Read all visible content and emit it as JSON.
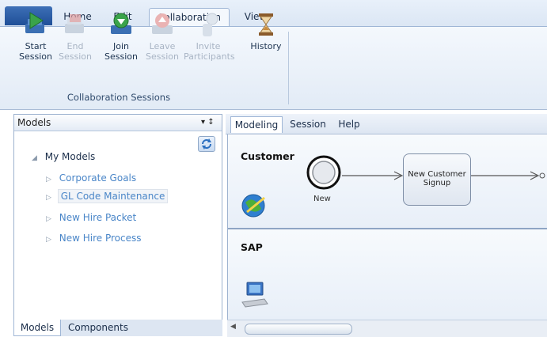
{
  "ribbon": {
    "tabs": [
      "Home",
      "Edit",
      "Collaboration",
      "View"
    ],
    "active_tab": "Collaboration",
    "buttons": [
      {
        "line1": "Start",
        "line2": "Session",
        "icon": "start-session-icon",
        "enabled": true
      },
      {
        "line1": "End",
        "line2": "Session",
        "icon": "end-session-icon",
        "enabled": false
      },
      {
        "line1": "Join",
        "line2": "Session",
        "icon": "join-session-icon",
        "enabled": true
      },
      {
        "line1": "Leave",
        "line2": "Session",
        "icon": "leave-session-icon",
        "enabled": false
      },
      {
        "line1": "Invite",
        "line2": "Participants",
        "icon": "invite-participants-icon",
        "enabled": false
      },
      {
        "line1": "History",
        "line2": "",
        "icon": "history-icon",
        "enabled": true
      }
    ],
    "group_label": "Collaboration Sessions"
  },
  "models_panel": {
    "title": "Models",
    "pin_glyph": "▾ ↕",
    "root": "My Models",
    "items": [
      "Corporate Goals",
      "GL Code Maintenance",
      "New Hire Packet",
      "New Hire Process"
    ],
    "selected_item": "GL Code Maintenance",
    "bottom_tabs": [
      "Models",
      "Components"
    ]
  },
  "editor": {
    "tabs": [
      "Modeling",
      "Session",
      "Help"
    ],
    "active_tab": "Modeling",
    "lanes": [
      {
        "label": "Customer"
      },
      {
        "label": "SAP"
      }
    ],
    "start_event_label": "New",
    "task_label_line1": "New Customer",
    "task_label_line2": "Signup"
  },
  "colors": {
    "accent": "#2b5ea8",
    "tree_link": "#4a86c8",
    "disabled": "#a8b4c4"
  }
}
